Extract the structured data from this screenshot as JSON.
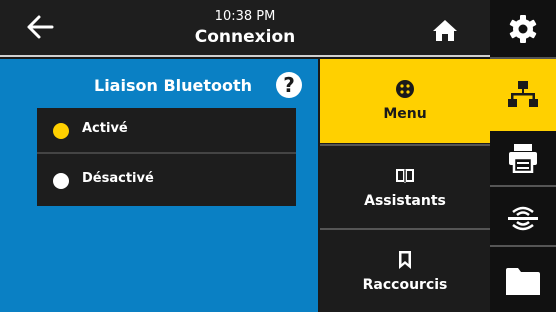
{
  "header": {
    "time": "10:38 PM",
    "title": "Connexion"
  },
  "panel": {
    "title": "Liaison Bluetooth",
    "help_symbol": "?",
    "options": [
      {
        "label": "Activé",
        "selected": true,
        "color": "#ffd000"
      },
      {
        "label": "Désactivé",
        "selected": false,
        "color": "#ffffff"
      }
    ]
  },
  "menu": {
    "items": [
      {
        "label": "Menu",
        "icon": "menu-dots-icon",
        "active": true
      },
      {
        "label": "Assistants",
        "icon": "book-icon",
        "active": false
      },
      {
        "label": "Raccourcis",
        "icon": "bookmark-icon",
        "active": false
      }
    ]
  },
  "sidebar": {
    "items": [
      {
        "icon": "gear-icon",
        "active": false
      },
      {
        "icon": "network-icon",
        "active": true
      },
      {
        "icon": "printer-icon",
        "active": false
      },
      {
        "icon": "rfid-sensor-icon",
        "active": false
      },
      {
        "icon": "folder-icon",
        "active": false
      }
    ]
  },
  "colors": {
    "accent": "#ffd000",
    "panel_blue": "#0a80c4",
    "dark": "#1c1c1c"
  }
}
